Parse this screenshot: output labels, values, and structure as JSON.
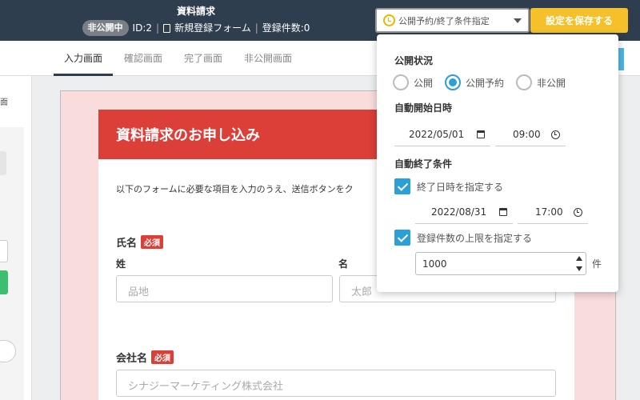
{
  "header": {
    "title": "資料請求",
    "status_badge": "非公開中",
    "id_text": "ID:2",
    "form_type": "新規登録フォーム",
    "count_text": "登録件数:0",
    "status_select_value": "公開予約/終了条件指定",
    "save_label": "設定を保存する"
  },
  "tabs": [
    {
      "label": "入力画面"
    },
    {
      "label": "確認画面"
    },
    {
      "label": "完了画面"
    },
    {
      "label": "非公開画面"
    }
  ],
  "left_panel": {
    "fragment_text": "面"
  },
  "form": {
    "heading": "資料請求のお申し込み",
    "intro": "以下のフォームに必要な項目を入力のうえ、送信ボタンをク",
    "name_label": "氏名",
    "required_badge": "必須",
    "last_name_label": "姓",
    "first_name_label": "名",
    "last_name_placeholder": "品地",
    "first_name_placeholder": "太郎",
    "company_label": "会社名",
    "company_placeholder": "シナジーマーケティング株式会社"
  },
  "popup": {
    "status_heading": "公開状況",
    "radio_options": [
      {
        "label": "公開",
        "selected": false
      },
      {
        "label": "公開予約",
        "selected": true
      },
      {
        "label": "非公開",
        "selected": false
      }
    ],
    "auto_start_heading": "自動開始日時",
    "start_date": "2022/05/01",
    "start_time": "09:00",
    "auto_end_heading": "自動終了条件",
    "end_datetime_check_label": "終了日時を指定する",
    "end_datetime_checked": true,
    "end_date": "2022/08/31",
    "end_time": "17:00",
    "limit_check_label": "登録件数の上限を指定する",
    "limit_checked": true,
    "limit_value": "1000",
    "limit_unit": "件"
  },
  "colors": {
    "header_bg": "#2f3e4e",
    "save_button": "#f5c02a",
    "form_header": "#dc3f38",
    "accent": "#2a9fd8"
  }
}
